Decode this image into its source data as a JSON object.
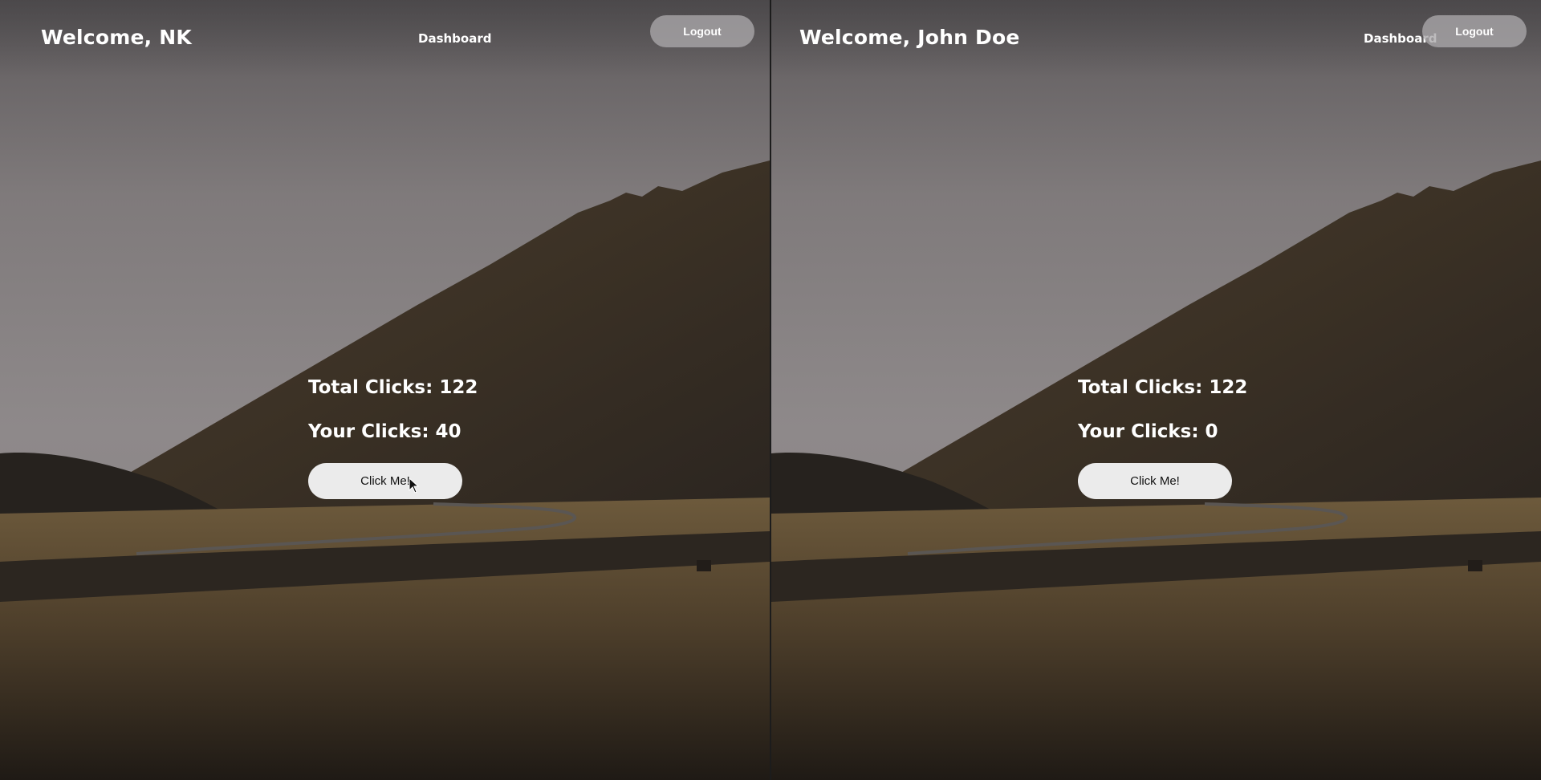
{
  "panes": [
    {
      "welcome": "Welcome, NK",
      "nav_label": "Dashboard",
      "logout_label": "Logout",
      "total_clicks": "Total Clicks: 122",
      "your_clicks": "Your Clicks: 40",
      "button_label": "Click Me!"
    },
    {
      "welcome": "Welcome, John Doe",
      "nav_label": "Dashboard",
      "logout_label": "Logout",
      "total_clicks": "Total Clicks: 122",
      "your_clicks": "Your Clicks: 0",
      "button_label": "Click Me!"
    }
  ],
  "colors": {
    "sky": "#8a8585",
    "mountain": "#3a3024",
    "field": "#5a4a32",
    "button_bg": "#ebebeb",
    "logout_bg": "#aaa8aa"
  },
  "icons": {
    "cursor": "mouse-pointer-icon"
  }
}
